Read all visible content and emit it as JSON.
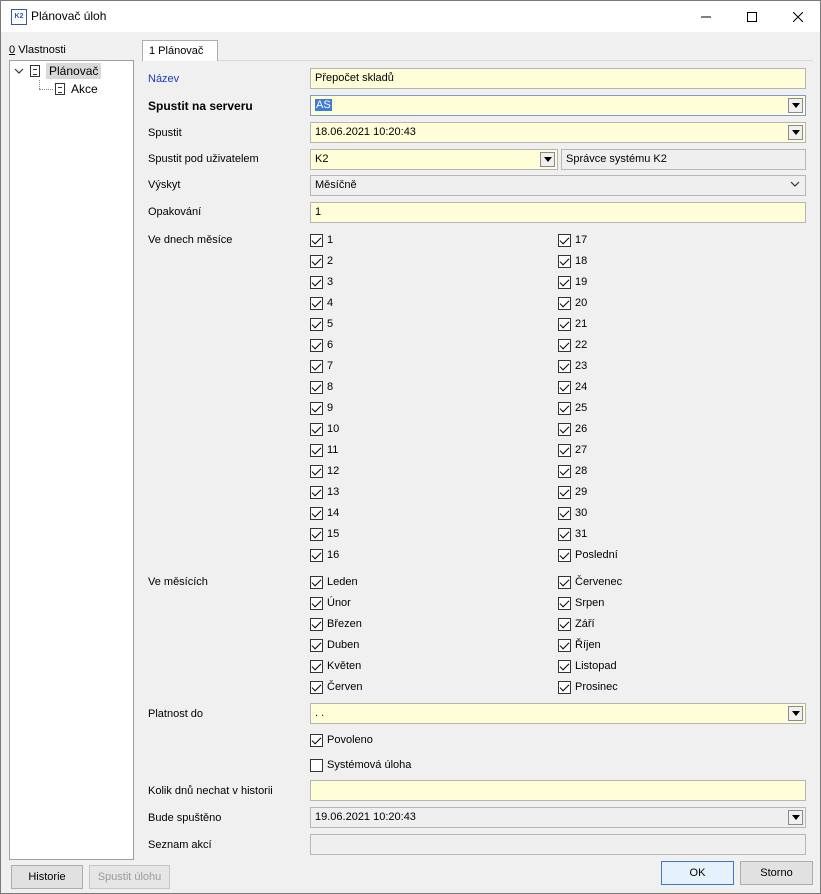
{
  "window": {
    "title": "Plánovač úloh",
    "app_icon": "K2"
  },
  "left_panel": {
    "header_hotkey": "0",
    "header": "Vlastnosti",
    "tree": [
      {
        "label": "Plánovač",
        "expanded": true
      },
      {
        "label": "Akce"
      }
    ]
  },
  "tab": {
    "label": "1 Plánovač"
  },
  "form": {
    "nazev": {
      "label": "Název",
      "value": "Přepočet skladů"
    },
    "server": {
      "label": "Spustit na serveru",
      "value": "AS"
    },
    "spustit": {
      "label": "Spustit",
      "value": "18.06.2021 10:20:43"
    },
    "uzivatel": {
      "label": "Spustit pod uživatelem",
      "value": "K2",
      "name": "Správce systému K2"
    },
    "vyskyt": {
      "label": "Výskyt",
      "value": "Měsíčně"
    },
    "opakovani": {
      "label": "Opakování",
      "value": "1"
    },
    "dny": {
      "label": "Ve dnech měsíce",
      "col1": [
        "1",
        "2",
        "3",
        "4",
        "5",
        "6",
        "7",
        "8",
        "9",
        "10",
        "11",
        "12",
        "13",
        "14",
        "15",
        "16"
      ],
      "col2": [
        "17",
        "18",
        "19",
        "20",
        "21",
        "22",
        "23",
        "24",
        "25",
        "26",
        "27",
        "28",
        "29",
        "30",
        "31",
        "Poslední"
      ]
    },
    "mesice": {
      "label": "Ve měsících",
      "col1": [
        "Leden",
        "Únor",
        "Březen",
        "Duben",
        "Květen",
        "Červen"
      ],
      "col2": [
        "Červenec",
        "Srpen",
        "Září",
        "Říjen",
        "Listopad",
        "Prosinec"
      ]
    },
    "platnost": {
      "label": "Platnost do",
      "value": " .  ."
    },
    "povoleno": {
      "label": "Povoleno",
      "checked": true
    },
    "systemova": {
      "label": "Systémová úloha",
      "checked": false
    },
    "historie_dnu": {
      "label": "Kolik dnů nechat v historii",
      "value": ""
    },
    "bude": {
      "label": "Bude spuštěno",
      "value": "19.06.2021 10:20:43"
    },
    "seznam": {
      "label": "Seznam akcí",
      "value": ""
    }
  },
  "buttons": {
    "historie": "Historie",
    "spustit_ulohu": "Spustit úlohu",
    "ok": "OK",
    "storno": "Storno"
  }
}
